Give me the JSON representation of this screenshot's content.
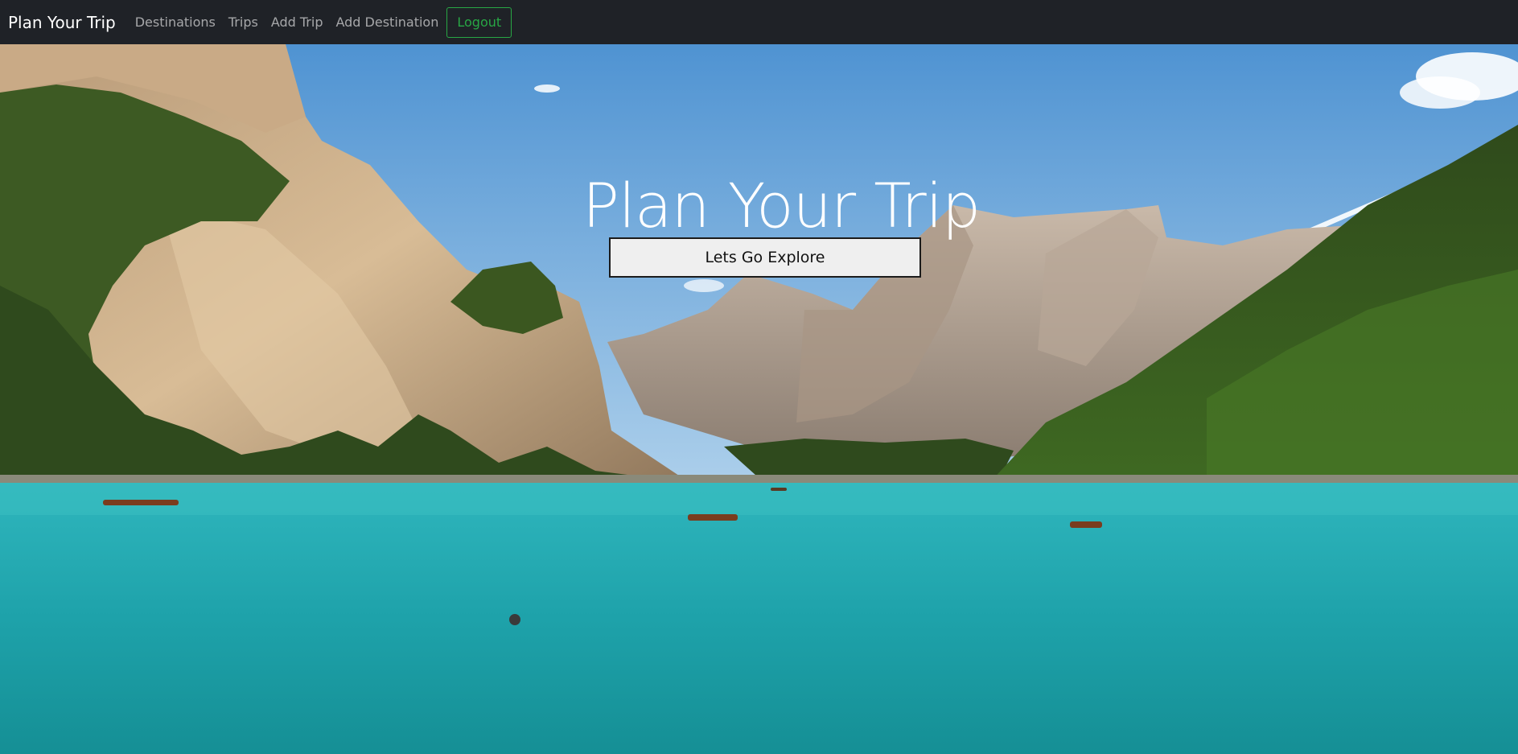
{
  "navbar": {
    "brand": "Plan Your Trip",
    "links": [
      "Destinations",
      "Trips",
      "Add Trip",
      "Add Destination"
    ],
    "logout_label": "Logout"
  },
  "hero": {
    "title": "Plan Your Trip",
    "cta_label": "Lets Go Explore"
  },
  "colors": {
    "navbar_bg": "#1f2227",
    "logout_accent": "#28a745",
    "sky": "#6fa8d8",
    "lake": "#1fa9b0"
  }
}
